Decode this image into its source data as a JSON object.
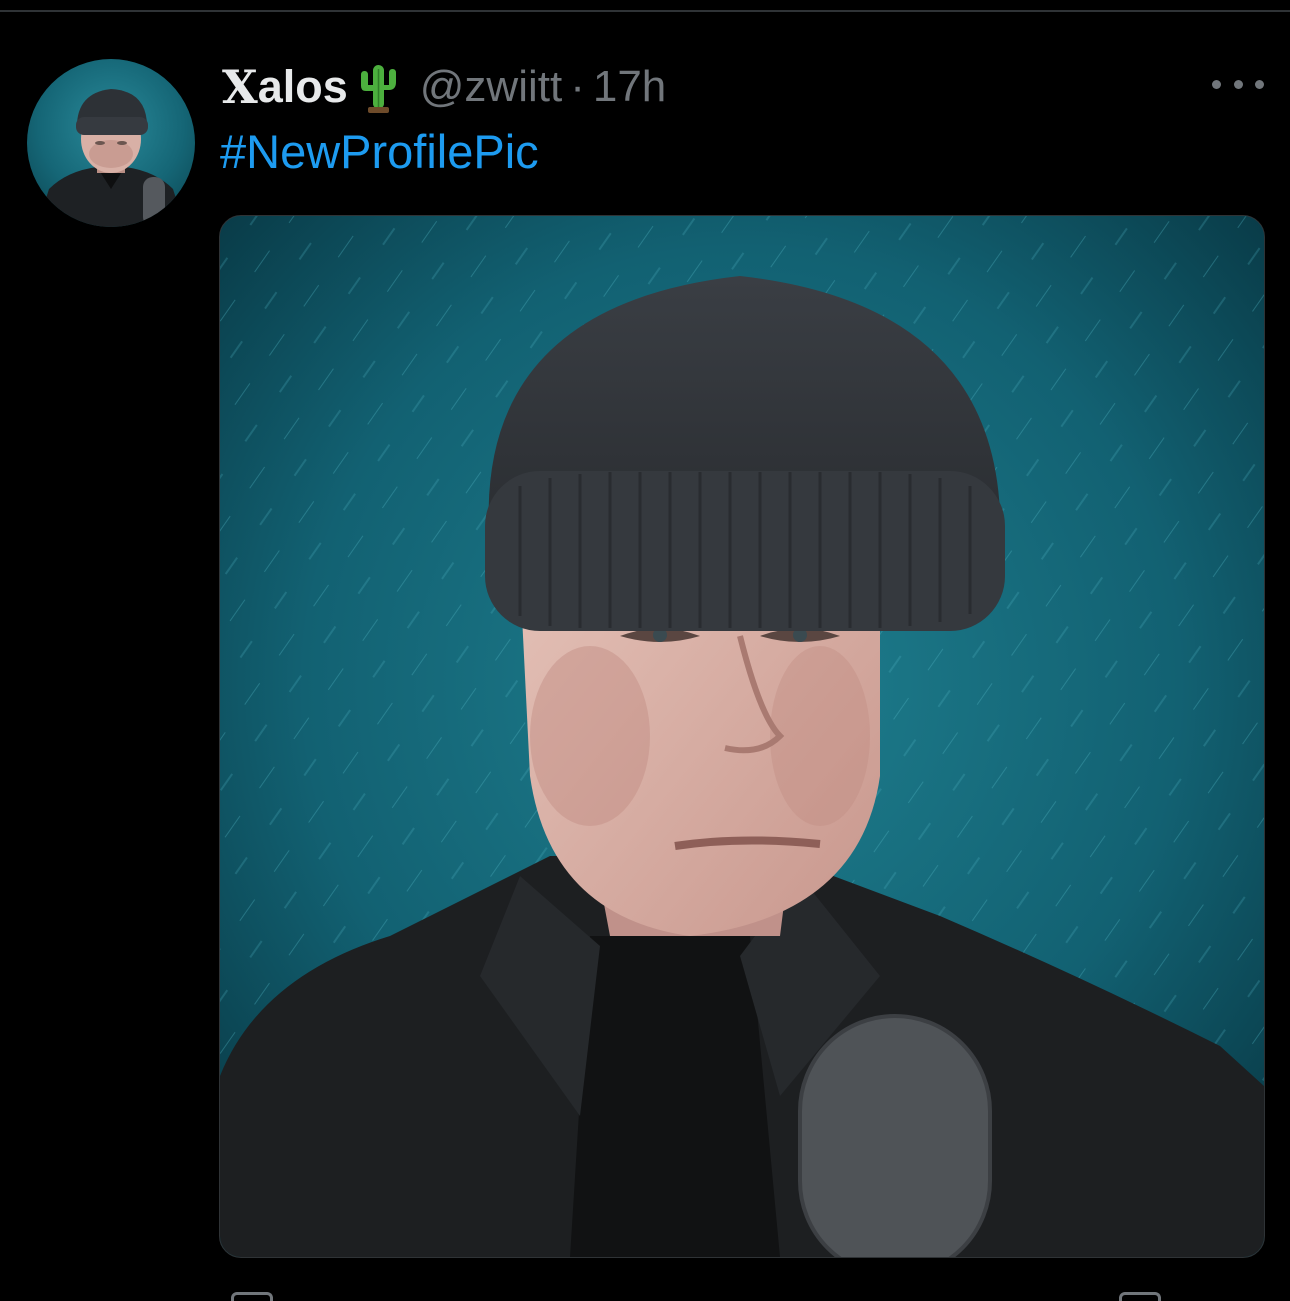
{
  "tweet": {
    "x_prefix": "X",
    "display_name": "alos",
    "name_emoji": "cactus",
    "handle": "@zwiitt",
    "separator": "·",
    "timestamp": "17h",
    "text": "#NewProfilePic"
  },
  "icons": {
    "more": "more-horizontal-icon",
    "cactus": "cactus-emoji-icon"
  },
  "colors": {
    "background": "#000000",
    "text_primary": "#e7e9ea",
    "text_secondary": "#71767b",
    "link": "#1d9bf0",
    "media_bg": "#0f4f5e"
  }
}
